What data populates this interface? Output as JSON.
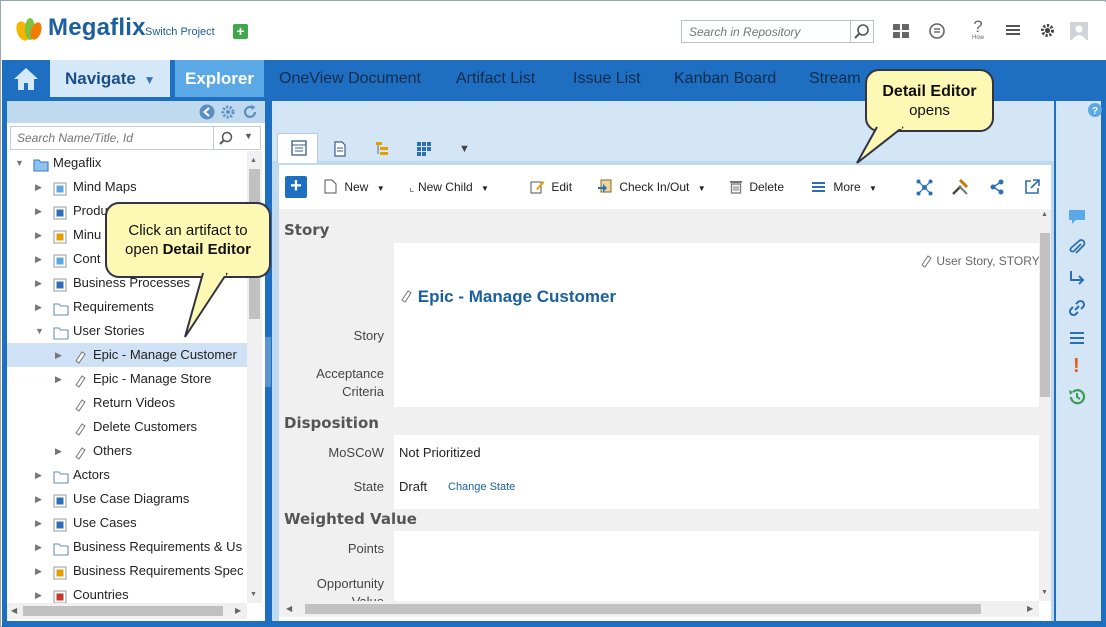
{
  "app": {
    "title": "Megaflix",
    "switch_project": "Switch Project"
  },
  "header": {
    "search_placeholder": "Search in Repository",
    "how_label": "How"
  },
  "nav": {
    "navigate": "Navigate",
    "explorer": "Explorer",
    "tabs": [
      "OneView Document",
      "Artifact List",
      "Issue List",
      "Kanban Board",
      "Stream"
    ]
  },
  "explorer": {
    "search_placeholder": "Search Name/Title, Id",
    "tree": [
      {
        "label": "Megaflix",
        "icon": "folder-open-icon"
      },
      {
        "label": "Mind Maps",
        "icon": "mindmap-icon"
      },
      {
        "label": "Produ",
        "icon": "pin-icon"
      },
      {
        "label": "Minu",
        "icon": "minutes-icon"
      },
      {
        "label": "Cont",
        "icon": "context-icon"
      },
      {
        "label": "Business Processes",
        "icon": "process-icon"
      },
      {
        "label": "Requirements",
        "icon": "folder-icon"
      },
      {
        "label": "User Stories",
        "icon": "folder-icon"
      },
      {
        "label": "Epic - Manage Customer",
        "icon": "story-icon"
      },
      {
        "label": "Epic - Manage Store",
        "icon": "story-icon"
      },
      {
        "label": "Return Videos",
        "icon": "story-icon"
      },
      {
        "label": "Delete Customers",
        "icon": "story-icon"
      },
      {
        "label": "Others",
        "icon": "story-icon"
      },
      {
        "label": "Actors",
        "icon": "folder-icon"
      },
      {
        "label": "Use Case Diagrams",
        "icon": "diagram-icon"
      },
      {
        "label": "Use Cases",
        "icon": "usecase-icon"
      },
      {
        "label": "Business Requirements & Us",
        "icon": "folder-icon"
      },
      {
        "label": "Business Requirements Spec",
        "icon": "document-icon"
      },
      {
        "label": "Countries",
        "icon": "globe-icon"
      }
    ]
  },
  "toolbar": {
    "new": "New",
    "new_child": "New Child",
    "edit": "Edit",
    "check_in_out": "Check In/Out",
    "delete": "Delete",
    "more": "More"
  },
  "artifact": {
    "type_label": "User Story, STORY",
    "title": "Epic - Manage Customer",
    "sections": {
      "story": "Story",
      "disposition": "Disposition",
      "weighted_value": "Weighted Value"
    },
    "fields": {
      "story": "Story",
      "acceptance_criteria": "Acceptance Criteria",
      "moscow": "MoSCoW",
      "moscow_value": "Not Prioritized",
      "state": "State",
      "state_value": "Draft",
      "change_state": "Change State",
      "points": "Points",
      "opportunity_value": "Opportunity Value"
    }
  },
  "callouts": {
    "detail_editor_title": "Detail Editor",
    "detail_editor_sub": "opens",
    "click_artifact": "Click an artifact to open",
    "click_artifact_bold": "Detail Editor"
  },
  "colors": {
    "nav_blue": "#1e6fc2",
    "brand": "#1b5f9e",
    "callout": "#fdf8b3",
    "selection": "#cfe2f5"
  }
}
